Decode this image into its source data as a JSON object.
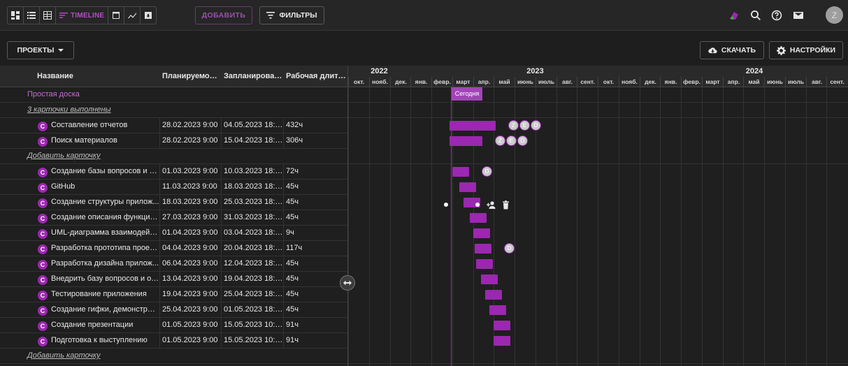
{
  "toolbar": {
    "views": [
      {
        "icon": "dashboard-icon"
      },
      {
        "icon": "list-icon"
      },
      {
        "icon": "table-icon"
      },
      {
        "icon": "timeline-icon",
        "label": "TIMELINE",
        "active": true
      },
      {
        "icon": "calendar-icon"
      },
      {
        "icon": "chart-line-icon"
      },
      {
        "icon": "archive-icon"
      }
    ],
    "add_label": "ДОБАВИТЬ",
    "filters_label": "ФИЛЬТРЫ",
    "user_initial": "Z"
  },
  "subbar": {
    "projects_label": "ПРОЕКТЫ",
    "download_label": "СКАЧАТЬ",
    "settings_label": "НАСТРОЙКИ"
  },
  "grid": {
    "columns": [
      "Название",
      "Планируемое н...",
      "Запланирован...",
      "Рабочая длите..."
    ],
    "rows": [
      {
        "type": "section",
        "name": "Простая доска"
      },
      {
        "type": "link",
        "name": "3 карточки выполнены"
      },
      {
        "type": "card",
        "badge": "C",
        "name": "Составление отчетов",
        "plan": "28.02.2023 9:00",
        "sched": "04.05.2023 18:00",
        "dur": "432ч"
      },
      {
        "type": "card",
        "badge": "C",
        "name": "Поиск материалов",
        "plan": "28.02.2023 9:00",
        "sched": "15.04.2023 18:00",
        "dur": "306ч"
      },
      {
        "type": "link",
        "name": "Добавить карточку"
      },
      {
        "type": "card",
        "badge": "C",
        "name": "Создание базы вопросов и о...",
        "plan": "01.03.2023 9:00",
        "sched": "10.03.2023 18:00",
        "dur": "72ч"
      },
      {
        "type": "card",
        "badge": "C",
        "name": "GitHub",
        "plan": "11.03.2023 9:00",
        "sched": "18.03.2023 18:00",
        "dur": "45ч"
      },
      {
        "type": "card",
        "badge": "C",
        "name": "Создание структуры прилож...",
        "plan": "18.03.2023 9:00",
        "sched": "25.03.2023 18:00",
        "dur": "45ч"
      },
      {
        "type": "card",
        "badge": "C",
        "name": "Создание описания функцио...",
        "plan": "27.03.2023 9:00",
        "sched": "31.03.2023 18:00",
        "dur": "45ч"
      },
      {
        "type": "card",
        "badge": "C",
        "name": "UML-диаграмма взаимодейс...",
        "plan": "01.04.2023 9:00",
        "sched": "03.04.2023 18:00",
        "dur": "9ч"
      },
      {
        "type": "card",
        "badge": "C",
        "name": "Разработка прототипа проек...",
        "plan": "04.04.2023 9:00",
        "sched": "20.04.2023 18:00",
        "dur": "117ч"
      },
      {
        "type": "card",
        "badge": "C",
        "name": "Разработка дизайна прилож...",
        "plan": "06.04.2023 9:00",
        "sched": "12.04.2023 18:00",
        "dur": "45ч"
      },
      {
        "type": "card",
        "badge": "C",
        "name": "Внедрить базу вопросов и от...",
        "plan": "13.04.2023 9:00",
        "sched": "19.04.2023 18:00",
        "dur": "45ч"
      },
      {
        "type": "card",
        "badge": "C",
        "name": "Тестирование приложения",
        "plan": "19.04.2023 9:00",
        "sched": "25.04.2023 18:00",
        "dur": "45ч"
      },
      {
        "type": "card",
        "badge": "C",
        "name": "Создание гифки, демонстрир...",
        "plan": "25.04.2023 9:00",
        "sched": "01.05.2023 18:00",
        "dur": "45ч"
      },
      {
        "type": "card",
        "badge": "C",
        "name": "Создание презентации",
        "plan": "01.05.2023 9:00",
        "sched": "15.05.2023 10:00",
        "dur": "91ч"
      },
      {
        "type": "card",
        "badge": "C",
        "name": "Подготовка к выступлению",
        "plan": "01.05.2023 9:00",
        "sched": "15.05.2023 10:00",
        "dur": "91ч"
      },
      {
        "type": "link",
        "name": "Добавить карточку"
      }
    ]
  },
  "timeline": {
    "years": [
      "2022",
      "2023",
      "2024"
    ],
    "months": [
      "окт.",
      "нояб.",
      "дек.",
      "янв.",
      "февр.",
      "март",
      "апр.",
      "май",
      "июнь",
      "июль",
      "авг.",
      "сент.",
      "окт.",
      "нояб.",
      "дек.",
      "янв.",
      "февр.",
      "март",
      "апр.",
      "май",
      "июнь",
      "июль",
      "авг.",
      "сент."
    ],
    "today_label": "Сегодня",
    "bar_color": "#9c27b0",
    "row_avatars": {
      "2": [
        "Z",
        "E",
        "D"
      ],
      "3": [
        "Z",
        "E",
        "D"
      ],
      "5": [
        "D"
      ],
      "10": [
        "D"
      ]
    }
  }
}
